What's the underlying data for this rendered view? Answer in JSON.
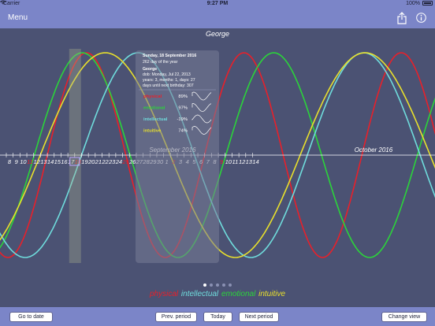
{
  "status_bar": {
    "carrier": "Carrier",
    "time": "9:27 PM",
    "battery": "100%"
  },
  "nav": {
    "menu_label": "Menu",
    "share_icon": "share-icon",
    "info_icon": "info-icon"
  },
  "chart_title": "George",
  "colors": {
    "background": "#4b5273",
    "bar": "#7b85c8",
    "physical": "#e8202a",
    "emotional": "#2bd43a",
    "intellectual": "#6fdcdc",
    "intuitive": "#e8e02c",
    "axis": "#ffffff",
    "sunday": "#e8202a"
  },
  "chart_data": {
    "type": "line",
    "x_unit": "day of year 2016",
    "x_range": [
      220,
      289
    ],
    "y_range": [
      -100,
      100
    ],
    "birth_date": "2013-07-22",
    "series": [
      {
        "name": "physical",
        "period_days": 23,
        "value_at_selected": 89
      },
      {
        "name": "emotional",
        "period_days": 28,
        "value_at_selected": 97
      },
      {
        "name": "intellectual",
        "period_days": 33,
        "value_at_selected": -19
      },
      {
        "name": "intuitive",
        "period_days": 38,
        "value_at_selected": 74
      }
    ],
    "month_labels": [
      {
        "text": "September 2016",
        "at_day": 245
      },
      {
        "text": "October 2016",
        "at_day": 275
      }
    ],
    "ticks": [
      {
        "day": 8,
        "doy": 221
      },
      {
        "day": 9,
        "doy": 222
      },
      {
        "day": 10,
        "doy": 223
      },
      {
        "day": 11,
        "doy": 224,
        "sunday": true
      },
      {
        "day": 12,
        "doy": 225
      },
      {
        "day": 13,
        "doy": 226
      },
      {
        "day": 14,
        "doy": 227
      },
      {
        "day": 15,
        "doy": 228
      },
      {
        "day": 16,
        "doy": 229
      },
      {
        "day": 17,
        "doy": 230
      },
      {
        "day": 18,
        "doy": 231,
        "sunday": true
      },
      {
        "day": 19,
        "doy": 232
      },
      {
        "day": 20,
        "doy": 233
      },
      {
        "day": 21,
        "doy": 234
      },
      {
        "day": 22,
        "doy": 235
      },
      {
        "day": 23,
        "doy": 236
      },
      {
        "day": 24,
        "doy": 237
      },
      {
        "day": 25,
        "doy": 238,
        "sunday": true
      },
      {
        "day": 26,
        "doy": 239
      },
      {
        "day": 27,
        "doy": 240
      },
      {
        "day": 28,
        "doy": 241
      },
      {
        "day": 29,
        "doy": 242
      },
      {
        "day": 30,
        "doy": 243
      },
      {
        "day": 1,
        "doy": 244
      },
      {
        "day": 2,
        "doy": 245,
        "sunday": true
      },
      {
        "day": 3,
        "doy": 246
      },
      {
        "day": 4,
        "doy": 247
      },
      {
        "day": 5,
        "doy": 248
      },
      {
        "day": 6,
        "doy": 249
      },
      {
        "day": 7,
        "doy": 250
      },
      {
        "day": 8,
        "doy": 251
      },
      {
        "day": 9,
        "doy": 252,
        "sunday": true
      },
      {
        "day": 10,
        "doy": 253
      },
      {
        "day": 11,
        "doy": 254
      },
      {
        "day": 12,
        "doy": 255
      },
      {
        "day": 13,
        "doy": 256
      },
      {
        "day": 14,
        "doy": 257
      }
    ],
    "selected_day": 231
  },
  "info_panel": {
    "date": "Sunday, 18 September 2016",
    "day_of_year": "262 day of the year",
    "name": "George",
    "dob": "dob: Monday, Jul 22, 2013",
    "age": "years: 3, months: 1, days: 27",
    "until_birthday": "days until next birthday: 307",
    "rows": [
      {
        "label": "physical",
        "value": "89%"
      },
      {
        "label": "emotional",
        "value": "97%"
      },
      {
        "label": "intellectual",
        "value": "-19%"
      },
      {
        "label": "intuitive",
        "value": "74%"
      }
    ]
  },
  "pager": {
    "pages": 5,
    "current": 1
  },
  "legend": [
    "physical",
    "intellectual",
    "emotional",
    "intuitive"
  ],
  "toolbar": {
    "goto_label": "Go to date",
    "prev_label": "Prev. period",
    "today_label": "Today",
    "next_label": "Next period",
    "change_label": "Change view"
  }
}
